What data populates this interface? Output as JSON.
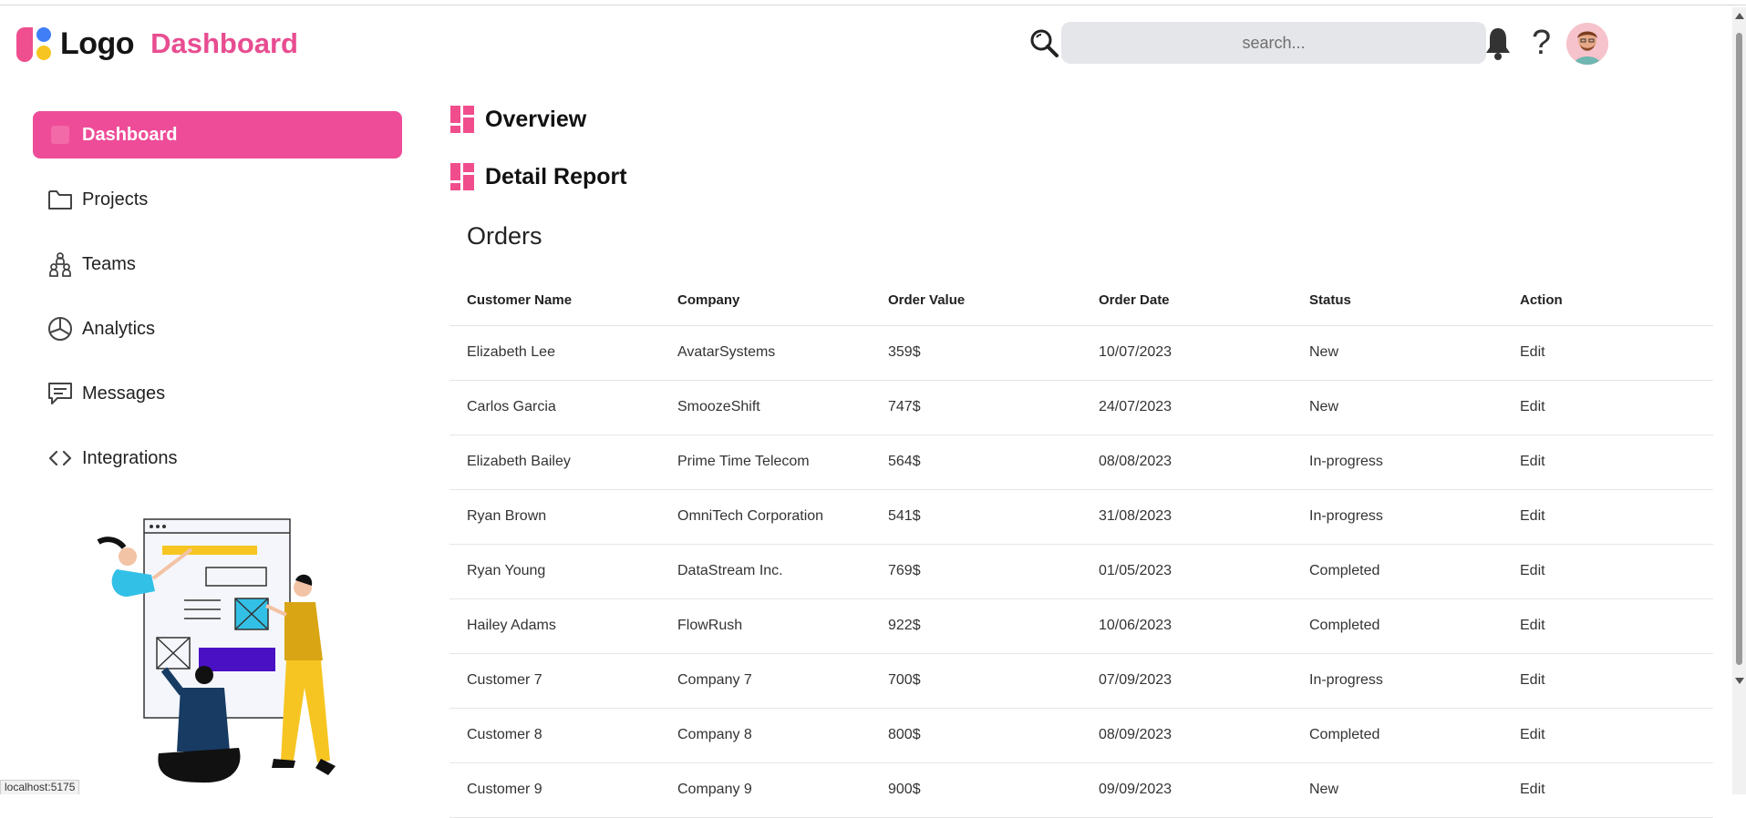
{
  "header": {
    "logo_text": "Logo",
    "title": "Dashboard",
    "search_placeholder": "search...",
    "help_glyph": "?",
    "icons": [
      "search-icon",
      "bell-icon",
      "help-icon",
      "avatar"
    ]
  },
  "colors": {
    "brand_pink": "#e84d91",
    "active_item": "#ee4c98",
    "logo_blue": "#3f7ef7",
    "logo_yellow": "#f6c521"
  },
  "sidebar": {
    "items": [
      {
        "label": "Dashboard",
        "icon": "dashboard-icon",
        "active": true
      },
      {
        "label": "Projects",
        "icon": "folder-icon",
        "active": false
      },
      {
        "label": "Teams",
        "icon": "teams-icon",
        "active": false
      },
      {
        "label": "Analytics",
        "icon": "pie-chart-icon",
        "active": false
      },
      {
        "label": "Messages",
        "icon": "message-icon",
        "active": false
      },
      {
        "label": "Integrations",
        "icon": "code-icon",
        "active": false
      }
    ]
  },
  "main": {
    "sections": [
      "Overview",
      "Detail Report"
    ],
    "orders": {
      "title": "Orders",
      "columns": [
        "Customer Name",
        "Company",
        "Order Value",
        "Order Date",
        "Status",
        "Action"
      ],
      "rows": [
        [
          "Elizabeth Lee",
          "AvatarSystems",
          "359$",
          "10/07/2023",
          "New",
          "Edit"
        ],
        [
          "Carlos Garcia",
          "SmoozeShift",
          "747$",
          "24/07/2023",
          "New",
          "Edit"
        ],
        [
          "Elizabeth Bailey",
          "Prime Time Telecom",
          "564$",
          "08/08/2023",
          "In-progress",
          "Edit"
        ],
        [
          "Ryan Brown",
          "OmniTech Corporation",
          "541$",
          "31/08/2023",
          "In-progress",
          "Edit"
        ],
        [
          "Ryan Young",
          "DataStream Inc.",
          "769$",
          "01/05/2023",
          "Completed",
          "Edit"
        ],
        [
          "Hailey Adams",
          "FlowRush",
          "922$",
          "10/06/2023",
          "Completed",
          "Edit"
        ],
        [
          "Customer 7",
          "Company 7",
          "700$",
          "07/09/2023",
          "In-progress",
          "Edit"
        ],
        [
          "Customer 8",
          "Company 8",
          "800$",
          "08/09/2023",
          "Completed",
          "Edit"
        ],
        [
          "Customer 9",
          "Company 9",
          "900$",
          "09/09/2023",
          "New",
          "Edit"
        ]
      ]
    }
  },
  "statusbar": {
    "url": "localhost:5175"
  }
}
